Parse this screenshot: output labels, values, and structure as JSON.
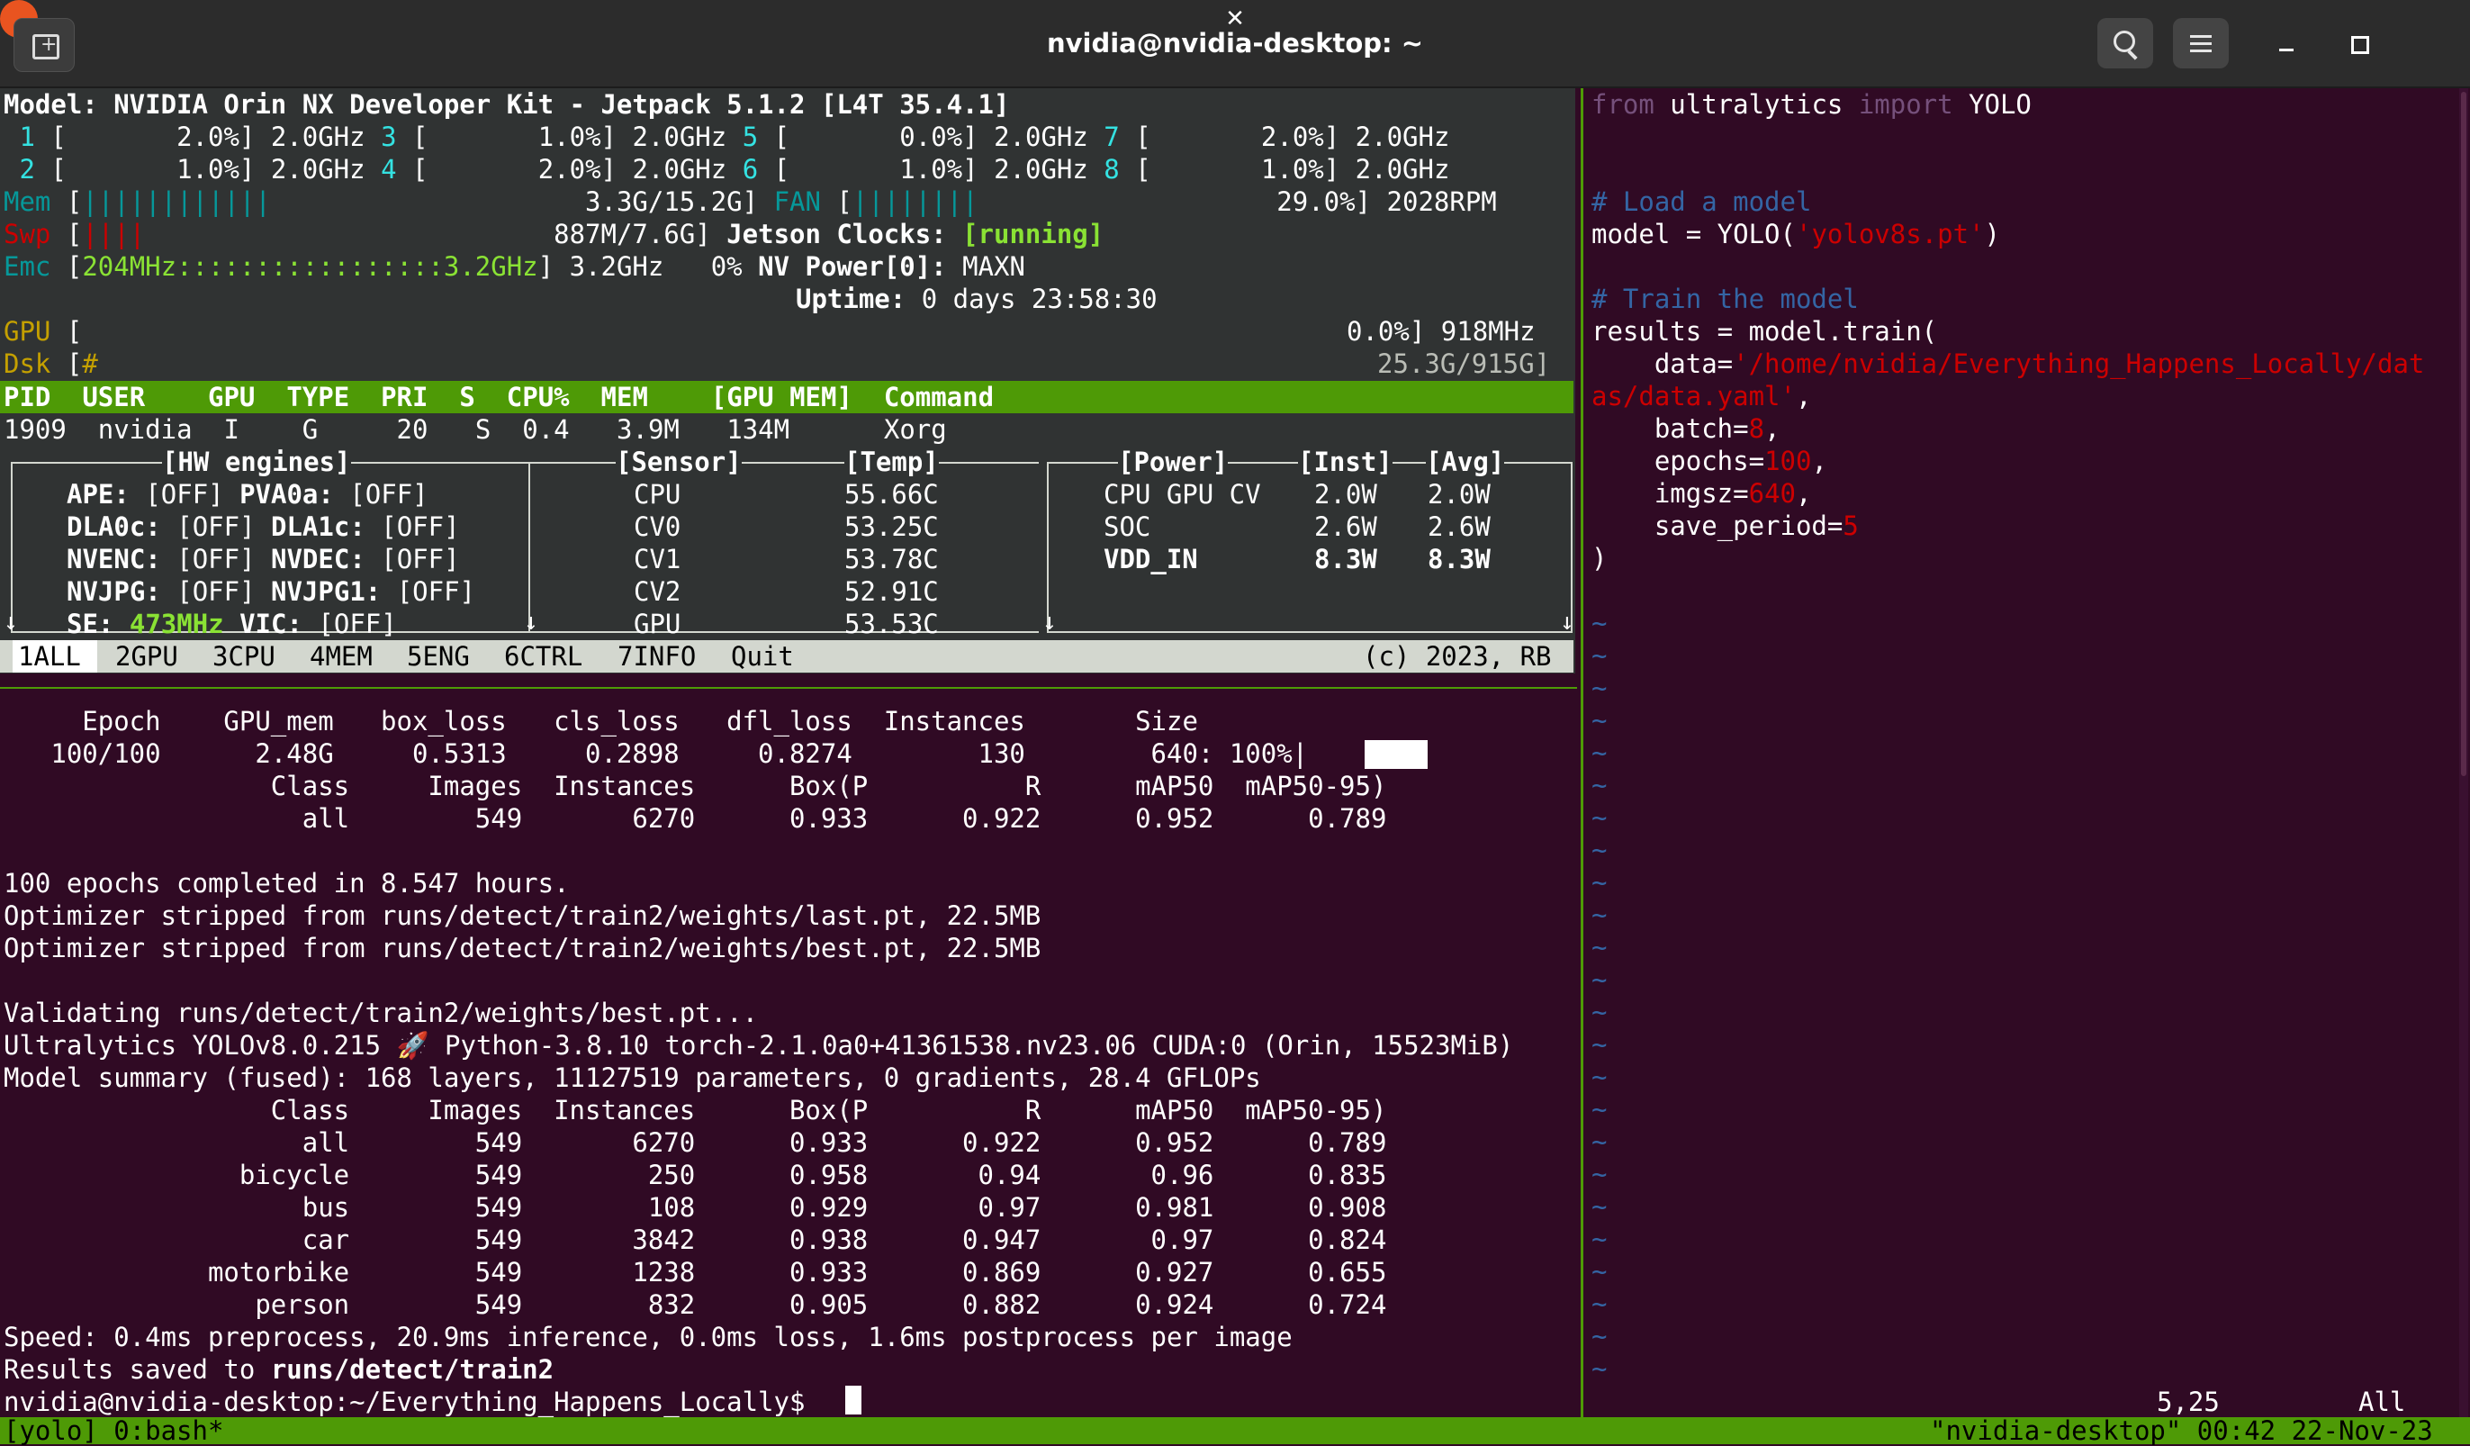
{
  "window": {
    "title": "nvidia@nvidia-desktop: ~"
  },
  "icons": [
    "new-tab-icon",
    "search-icon",
    "hamburger-menu-icon",
    "minimize-icon",
    "maximize-icon",
    "close-icon"
  ],
  "colors": {
    "terminal_bg": "#300a24",
    "jtop_bg": "#303333",
    "tmux_green": "#4e9a06",
    "cyan": "#06989a",
    "blue": "#3465a4",
    "red": "#cc0000",
    "yellow": "#c4a000",
    "close_button": "#e95420"
  },
  "jtop": {
    "model_line": "Model: NVIDIA Orin NX Developer Kit - Jetpack 5.1.2 [L4T 35.4.1]",
    "cpus": [
      {
        "num": "1",
        "pct": "2.0%",
        "freq": "2.0GHz"
      },
      {
        "num": "2",
        "pct": "1.0%",
        "freq": "2.0GHz"
      },
      {
        "num": "3",
        "pct": "1.0%",
        "freq": "2.0GHz"
      },
      {
        "num": "4",
        "pct": "2.0%",
        "freq": "2.0GHz"
      },
      {
        "num": "5",
        "pct": "0.0%",
        "freq": "2.0GHz"
      },
      {
        "num": "6",
        "pct": "1.0%",
        "freq": "2.0GHz"
      },
      {
        "num": "7",
        "pct": "2.0%",
        "freq": "2.0GHz"
      },
      {
        "num": "8",
        "pct": "1.0%",
        "freq": "2.0GHz"
      }
    ],
    "mem": {
      "label": "Mem",
      "bars": "||||||||||||",
      "value": "3.3G/15.2G]"
    },
    "fan": {
      "label": "FAN",
      "bars": "||||||||",
      "value": "29.0%]",
      "rpm": "2028RPM"
    },
    "swp": {
      "label": "Swp",
      "bars": "||||",
      "value": "887M/7.6G]"
    },
    "jetson_clocks": {
      "label": "Jetson Clocks:",
      "value": "[running]"
    },
    "emc": {
      "label": "Emc",
      "range": "204MHz:::::::::::::::::3.2GHz",
      "freq": "3.2GHz",
      "pct": "0%"
    },
    "nvpower": {
      "label": "NV Power[0]:",
      "value": "MAXN"
    },
    "uptime": {
      "label": "Uptime:",
      "value": "0 days 23:58:30"
    },
    "gpu": {
      "label": "GPU",
      "value": "0.0%]",
      "freq": "918MHz"
    },
    "dsk": {
      "label": "Dsk",
      "bars": "#",
      "value": "25.3G/915G]"
    },
    "proc_headers": [
      "PID",
      "USER",
      "GPU",
      "TYPE",
      "PRI",
      "S",
      "CPU%",
      "MEM",
      "[GPU MEM]",
      "Command"
    ],
    "proc_row": [
      "1909",
      "nvidia",
      "I",
      "G",
      "20",
      "S",
      "0.4",
      "3.9M",
      "134M",
      "Xorg"
    ],
    "sections": {
      "hw": "[HW engines]",
      "sensor": "[Sensor]",
      "temp": "[Temp]",
      "power": "[Power]",
      "inst": "[Inst]",
      "avg": "[Avg]"
    },
    "hw_engines": [
      {
        "a": "APE:",
        "av": "[OFF]",
        "b": "PVA0a:",
        "bv": "[OFF]"
      },
      {
        "a": "DLA0c:",
        "av": "[OFF]",
        "b": "DLA1c:",
        "bv": "[OFF]"
      },
      {
        "a": "NVENC:",
        "av": "[OFF]",
        "b": "NVDEC:",
        "bv": "[OFF]"
      },
      {
        "a": "NVJPG:",
        "av": "[OFF]",
        "b": "NVJPG1:",
        "bv": "[OFF]"
      },
      {
        "a": "SE:",
        "av": "473MHz",
        "b": "VIC:",
        "bv": "[OFF]"
      }
    ],
    "sensors": [
      {
        "name": "CPU",
        "temp": "55.66C"
      },
      {
        "name": "CV0",
        "temp": "53.25C"
      },
      {
        "name": "CV1",
        "temp": "53.78C"
      },
      {
        "name": "CV2",
        "temp": "52.91C"
      },
      {
        "name": "GPU",
        "temp": "53.53C"
      }
    ],
    "power": [
      {
        "name": "CPU GPU CV",
        "inst": "2.0W",
        "avg": "2.0W"
      },
      {
        "name": "SOC",
        "inst": "2.6W",
        "avg": "2.6W"
      },
      {
        "name": "VDD_IN",
        "inst": "8.3W",
        "avg": "8.3W"
      }
    ],
    "tabs": [
      {
        "num": "1",
        "label": "ALL"
      },
      {
        "num": "2",
        "label": "GPU"
      },
      {
        "num": "3",
        "label": "CPU"
      },
      {
        "num": "4",
        "label": "MEM"
      },
      {
        "num": "5",
        "label": "ENG"
      },
      {
        "num": "6",
        "label": "CTRL"
      },
      {
        "num": "7",
        "label": "INFO"
      },
      {
        "num": "",
        "label": "Quit"
      }
    ],
    "copyright": "(c) 2023, RB"
  },
  "training_output": {
    "epoch_header": "     Epoch    GPU_mem   box_loss   cls_loss   dfl_loss  Instances       Size",
    "epoch_row": "   100/100      2.48G     0.5313     0.2898     0.8274        130        640: 100%|",
    "class_header": "                 Class     Images  Instances      Box(P          R      mAP50  mAP50-95)",
    "all_row": "                   all        549       6270      0.933      0.922      0.952      0.789",
    "completed": "100 epochs completed in 8.547 hours.",
    "stripped_last": "Optimizer stripped from runs/detect/train2/weights/last.pt, 22.5MB",
    "stripped_best": "Optimizer stripped from runs/detect/train2/weights/best.pt, 22.5MB",
    "validating": "Validating runs/detect/train2/weights/best.pt...",
    "ultralytics": "Ultralytics YOLOv8.0.215 🚀 Python-3.8.10 torch-2.1.0a0+41361538.nv23.06 CUDA:0 (Orin, 15523MiB)",
    "model_summary": "Model summary (fused): 168 layers, 11127519 parameters, 0 gradients, 28.4 GFLOPs",
    "val_header": "                 Class     Images  Instances      Box(P          R      mAP50  mAP50-95)",
    "val_rows": [
      "                   all        549       6270      0.933      0.922      0.952      0.789",
      "               bicycle        549        250      0.958       0.94       0.96      0.835",
      "                   bus        549        108      0.929       0.97      0.981      0.908",
      "                   car        549       3842      0.938      0.947       0.97      0.824",
      "             motorbike        549       1238      0.933      0.869      0.927      0.655",
      "                person        549        832      0.905      0.882      0.924      0.724"
    ],
    "speed": "Speed: 0.4ms preprocess, 20.9ms inference, 0.0ms loss, 1.6ms postprocess per image",
    "results_prefix": "Results saved to ",
    "results_path": "runs/detect/train2",
    "prompt": "nvidia@nvidia-desktop:~/Everything_Happens_Locally$ "
  },
  "editor": {
    "kw_from": "from",
    "mod": " ultralytics ",
    "kw_import": "import",
    "cls": " YOLO",
    "comment_load": "# Load a model",
    "model_assign": "model = YOLO(",
    "model_str": "'yolov8s.pt'",
    "close_paren": ")",
    "comment_train": "# Train the model",
    "results_assign": "results = model.train(",
    "data_key": "    data=",
    "data_str_1": "'/home/nvidia/Everything_Happens_Locally/dat",
    "data_str_2": "as/data.yaml'",
    "comma": ",",
    "batch_key": "    batch=",
    "batch_val": "8",
    "epochs_key": "    epochs=",
    "epochs_val": "100",
    "imgsz_key": "    imgsz=",
    "imgsz_val": "640",
    "save_key": "    save_period=",
    "save_val": "5",
    "end_paren": ")",
    "tilde": "~",
    "position": "5,25",
    "scroll": "All"
  },
  "tmux": {
    "left": "[yolo] 0:bash*",
    "right": "\"nvidia-desktop\" 00:42 22-Nov-23"
  }
}
